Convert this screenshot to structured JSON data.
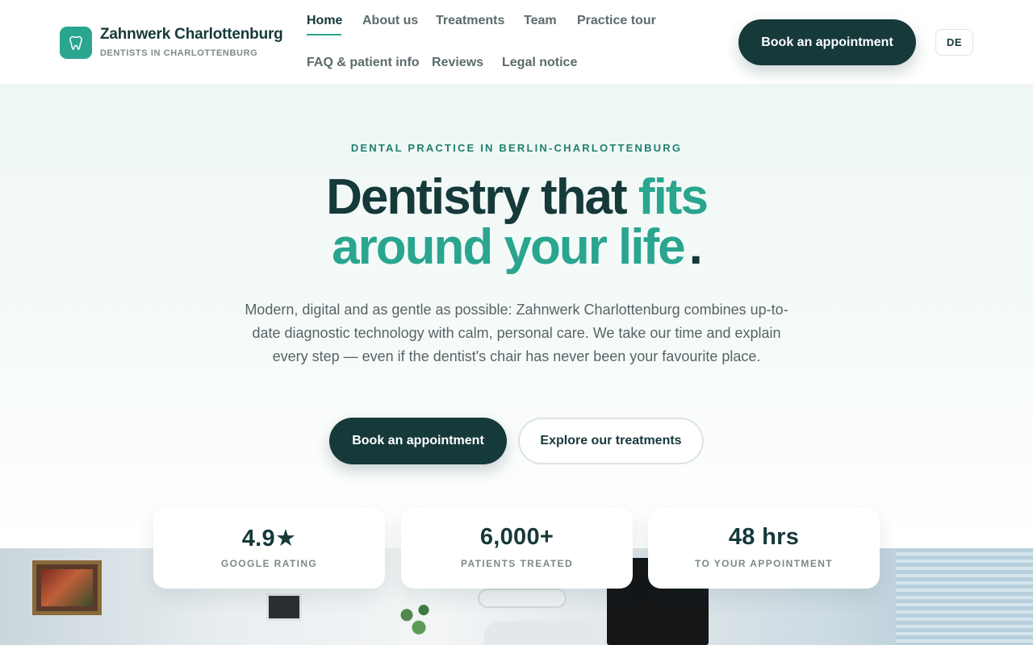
{
  "brand": {
    "name": "Zahnwerk Charlottenburg",
    "tagline": "DENTISTS IN CHARLOTTENBURG",
    "logo_icon": "tooth-icon",
    "accent_color": "#2aa58f",
    "dark_color": "#16393a"
  },
  "nav": {
    "items": [
      {
        "label": "Home",
        "active": true
      },
      {
        "label": "About us"
      },
      {
        "label": "Treatments"
      },
      {
        "label": "Team"
      },
      {
        "label": "Practice tour"
      },
      {
        "label": "FAQ & patient info"
      },
      {
        "label": "Reviews"
      },
      {
        "label": "Legal notice"
      }
    ],
    "cta_label": "Book an appointment",
    "language_label": "DE"
  },
  "hero": {
    "eyebrow": "DENTAL PRACTICE IN BERLIN-CHARLOTTENBURG",
    "headline_part1": "Dentistry that ",
    "headline_accent1": "fits",
    "headline_accent2": "around your life",
    "headline_end": ".",
    "lead": "Modern, digital and as gentle as possible: Zahnwerk Charlottenburg combines up-to-date diagnostic technology with calm, personal care. We take our time and explain every step — even if the dentist's chair has never been your favourite place.",
    "primary_cta": "Book an appointment",
    "secondary_cta": "Explore our treatments"
  },
  "stats": [
    {
      "value": "4.9★",
      "label": "GOOGLE RATING"
    },
    {
      "value": "6,000+",
      "label": "PATIENTS TREATED"
    },
    {
      "value": "48 hrs",
      "label": "TO YOUR APPOINTMENT"
    }
  ]
}
